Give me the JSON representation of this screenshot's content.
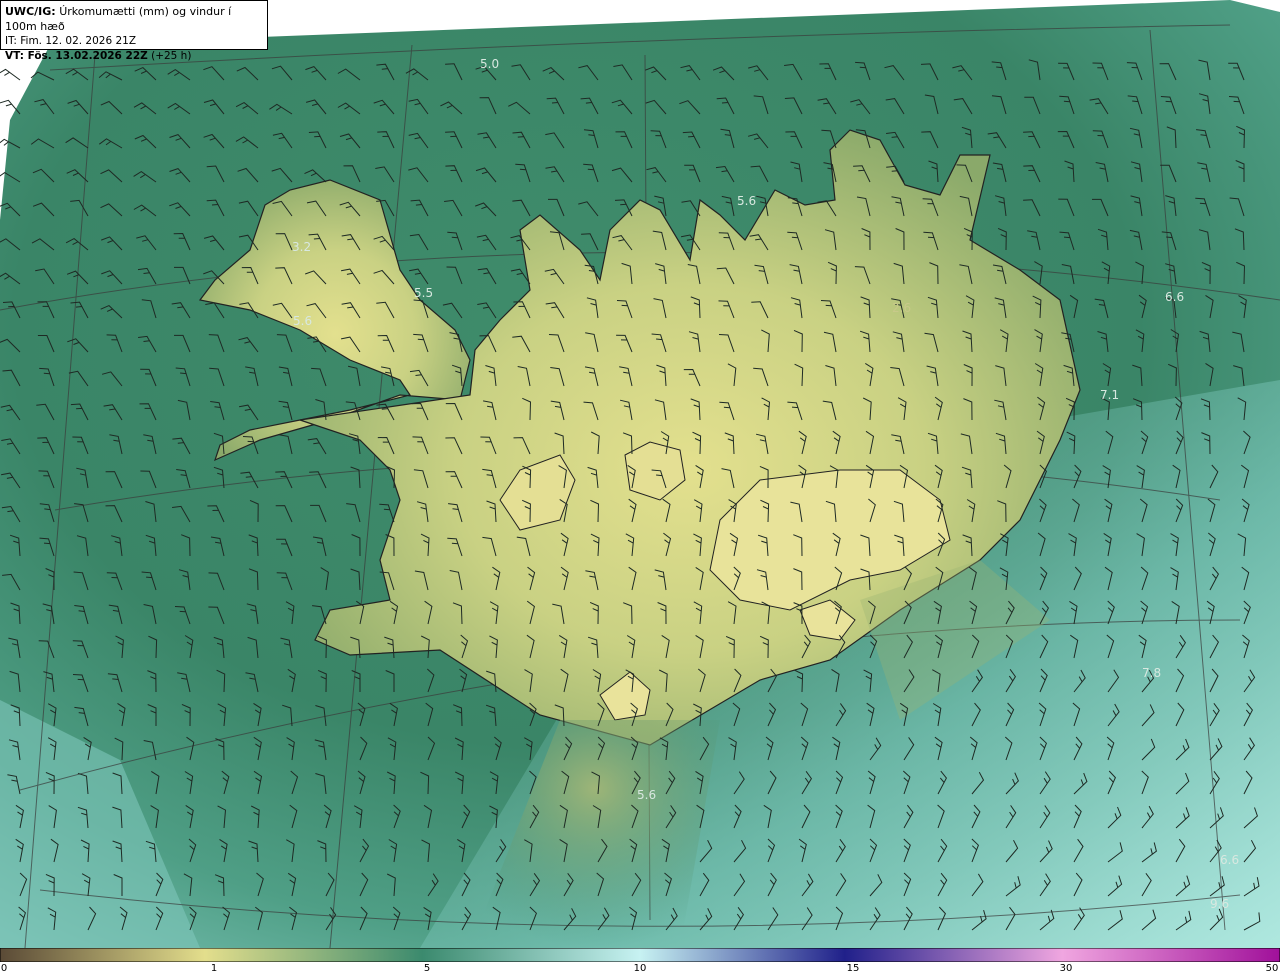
{
  "header": {
    "model": "UWC/IG:",
    "title": "Úrkomumætti (mm) og vindur í 100m hæð",
    "it_label": "IT:",
    "it_value": "Fim. 12. 02. 2026 21Z",
    "vt_label": "VT:",
    "vt_value": "Fös. 13.02.2026 22Z",
    "vt_offset": "(+25 h)"
  },
  "map": {
    "field_colors": {
      "sea_deep": "#2f7a5f",
      "sea_mid": "#3d8a6c",
      "sea_light": "#7fc9bf",
      "land_low": "#8fae6a",
      "land_high": "#d9dc8b",
      "coast": "#222222",
      "barb": "#1e2a24"
    },
    "value_labels": [
      {
        "text": "5.0"
      },
      {
        "text": "5.6"
      },
      {
        "text": "3.2"
      },
      {
        "text": "5.5"
      },
      {
        "text": "5.6"
      },
      {
        "text": "2.6"
      },
      {
        "text": "6.6"
      },
      {
        "text": "7.1"
      },
      {
        "text": "7.8"
      },
      {
        "text": "5.6"
      },
      {
        "text": "6.6"
      },
      {
        "text": "9.6"
      }
    ]
  },
  "colorbar": {
    "ticks": [
      "0",
      "1",
      "5",
      "10",
      "15",
      "30",
      "50"
    ],
    "stops": [
      "#5a4a36",
      "#b89a6a",
      "#e6e08c",
      "#3a8a6e",
      "#bff0f0",
      "#2a2a8a",
      "#e89ad8",
      "#a01a9a"
    ]
  }
}
